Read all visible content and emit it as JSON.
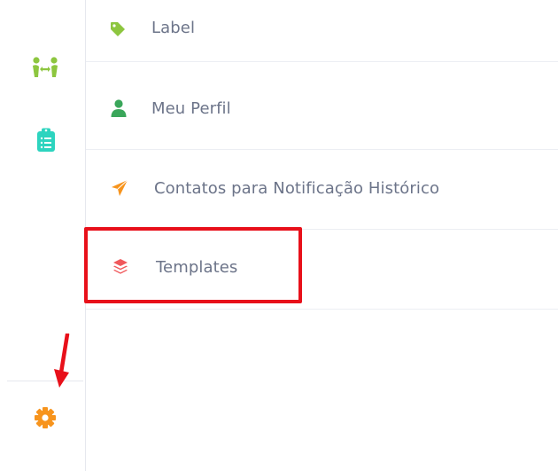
{
  "sidebar": {
    "icons": [
      {
        "name": "people-connect-icon",
        "color": "#8dc63f"
      },
      {
        "name": "clipboard-list-icon",
        "color": "#2dd4bf"
      },
      {
        "name": "gear-icon",
        "color": "#f7941d"
      }
    ]
  },
  "menu": {
    "items": [
      {
        "label": "Label",
        "icon": "tag-icon",
        "color": "#8dc63f"
      },
      {
        "label": "Meu Perfil",
        "icon": "user-icon",
        "color": "#3aa65a"
      },
      {
        "label": "Contatos para Notificação Histórico",
        "icon": "paper-plane-icon",
        "color": "#f7941d"
      },
      {
        "label": "Templates",
        "icon": "layers-icon",
        "color": "#f0595c"
      }
    ]
  },
  "annotations": {
    "highlight_color": "#e8101a",
    "highlighted_item": "Templates",
    "arrow_target": "gear-icon"
  }
}
